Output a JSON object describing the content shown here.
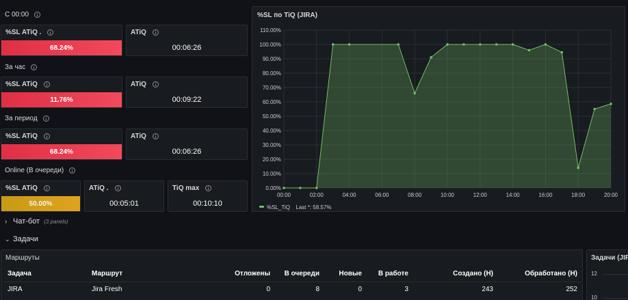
{
  "rows": {
    "since_midnight": "С 00:00",
    "per_hour": "За час",
    "per_period": "За период",
    "online": "Online (В очереди)"
  },
  "cards": {
    "sl_since_midnight": {
      "title": "%SL ATiQ .",
      "value": "68.24%"
    },
    "atiq_since_midnight": {
      "title": "ATiQ",
      "value": "00:06:26"
    },
    "sl_per_hour": {
      "title": "%SL ATiQ",
      "value": "11.76%"
    },
    "atiq_per_hour": {
      "title": "ATiQ",
      "value": "00:09:22"
    },
    "sl_per_period": {
      "title": "%SL ATiQ",
      "value": "68.24%"
    },
    "atiq_per_period": {
      "title": "ATiQ",
      "value": "00:06:26"
    },
    "sl_online": {
      "title": "%SL ATiQ",
      "value": "50.00%"
    },
    "atiq_online": {
      "title": "ATiQ .",
      "value": "00:05:01"
    },
    "tiq_max_online": {
      "title": "TiQ max",
      "value": "00:10:10"
    }
  },
  "sections": {
    "chatbot": {
      "label": "Чат-бот",
      "sub": "(3 panels)"
    },
    "tasks": {
      "label": "Задачи"
    }
  },
  "routes": {
    "title": "Маршруты",
    "columns": [
      "Задача",
      "Маршрут",
      "Отложены",
      "В очереди",
      "Новые",
      "В работе",
      "Создано (Н)",
      "Обработано (Н)"
    ],
    "rows": [
      [
        "JIRA",
        "Jira Fresh",
        "0",
        "8",
        "0",
        "3",
        "243",
        "252"
      ]
    ]
  },
  "tasks_panel": {
    "title": "Задачи (JIR",
    "ticks": [
      "12",
      "10"
    ]
  },
  "colors": {
    "background": "#111217",
    "panel": "#181b1f",
    "red": "#f2495c",
    "yellow": "#e0a220",
    "series": "#73bf69"
  },
  "chart_data": {
    "type": "area",
    "title": "%SL по TiQ (JIRA)",
    "x_ticks": [
      "00:00",
      "02:00",
      "04:00",
      "06:00",
      "08:00",
      "10:00",
      "12:00",
      "14:00",
      "16:00",
      "18:00",
      "20:00"
    ],
    "y_ticks": [
      "0.00%",
      "10.00%",
      "20.00%",
      "30.00%",
      "40.00%",
      "50.00%",
      "60.00%",
      "70.00%",
      "80.00%",
      "90.00%",
      "100.00%",
      "110.00%"
    ],
    "xlim": [
      0,
      20
    ],
    "ylim": [
      0,
      110
    ],
    "grid": true,
    "legend_position": "bottom-left",
    "series": [
      {
        "name": "%SL_TiQ",
        "legend_stat": "Last *: 58.57%",
        "color": "#73bf69",
        "points": [
          [
            0,
            0
          ],
          [
            1,
            0
          ],
          [
            2,
            0
          ],
          [
            3,
            100
          ],
          [
            4,
            100
          ],
          [
            7,
            100
          ],
          [
            8,
            66
          ],
          [
            9,
            91
          ],
          [
            10,
            100
          ],
          [
            11,
            100
          ],
          [
            12,
            100
          ],
          [
            13,
            100
          ],
          [
            14,
            100
          ],
          [
            15,
            96
          ],
          [
            16,
            100
          ],
          [
            17,
            94.5
          ],
          [
            18,
            14
          ],
          [
            19,
            55
          ],
          [
            20,
            58.57
          ]
        ]
      }
    ]
  }
}
